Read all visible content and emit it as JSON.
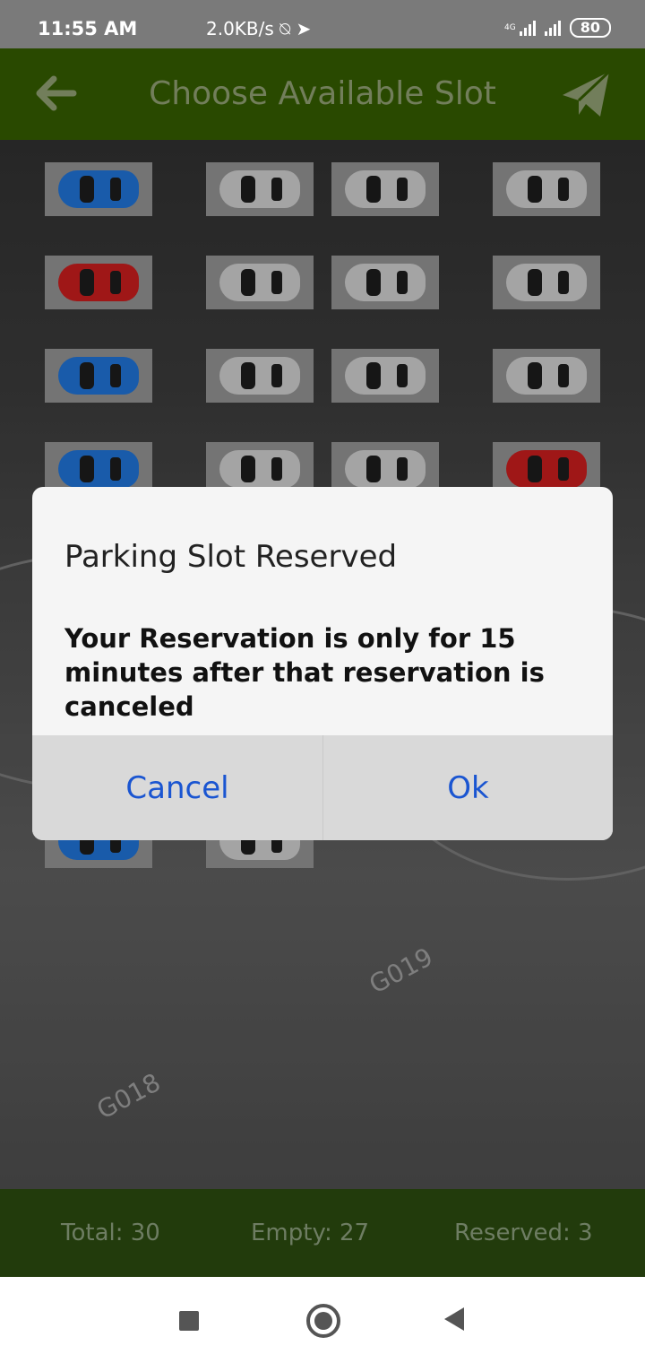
{
  "status_bar": {
    "time": "11:55 AM",
    "speed": "2.0KB/s",
    "network_label": "4G",
    "battery": "80"
  },
  "app_bar": {
    "title": "Choose Available Slot",
    "back_icon": "arrow-left-icon",
    "action_icon": "send-icon"
  },
  "parking_grid": {
    "rows": [
      [
        "blue",
        "gray",
        "gray",
        "gray"
      ],
      [
        "red",
        "gray",
        "gray",
        "gray"
      ],
      [
        "blue",
        "gray",
        "gray",
        "gray"
      ],
      [
        "blue",
        "gray",
        "gray",
        "red"
      ]
    ],
    "bottom_row": [
      "blue",
      "gray"
    ],
    "lot_markings": [
      "G019",
      "G018"
    ]
  },
  "dialog": {
    "title": "Parking Slot Reserved",
    "message": "Your Reservation is only for 15 minutes after that reservation is canceled",
    "cancel_label": "Cancel",
    "ok_label": "Ok"
  },
  "footer": {
    "total": "Total: 30",
    "empty": "Empty: 27",
    "reserved": "Reserved: 3"
  },
  "colors": {
    "app_bar": "#335a00",
    "footer": "#223b0c",
    "dialog_button_text": "#1a55d1"
  }
}
